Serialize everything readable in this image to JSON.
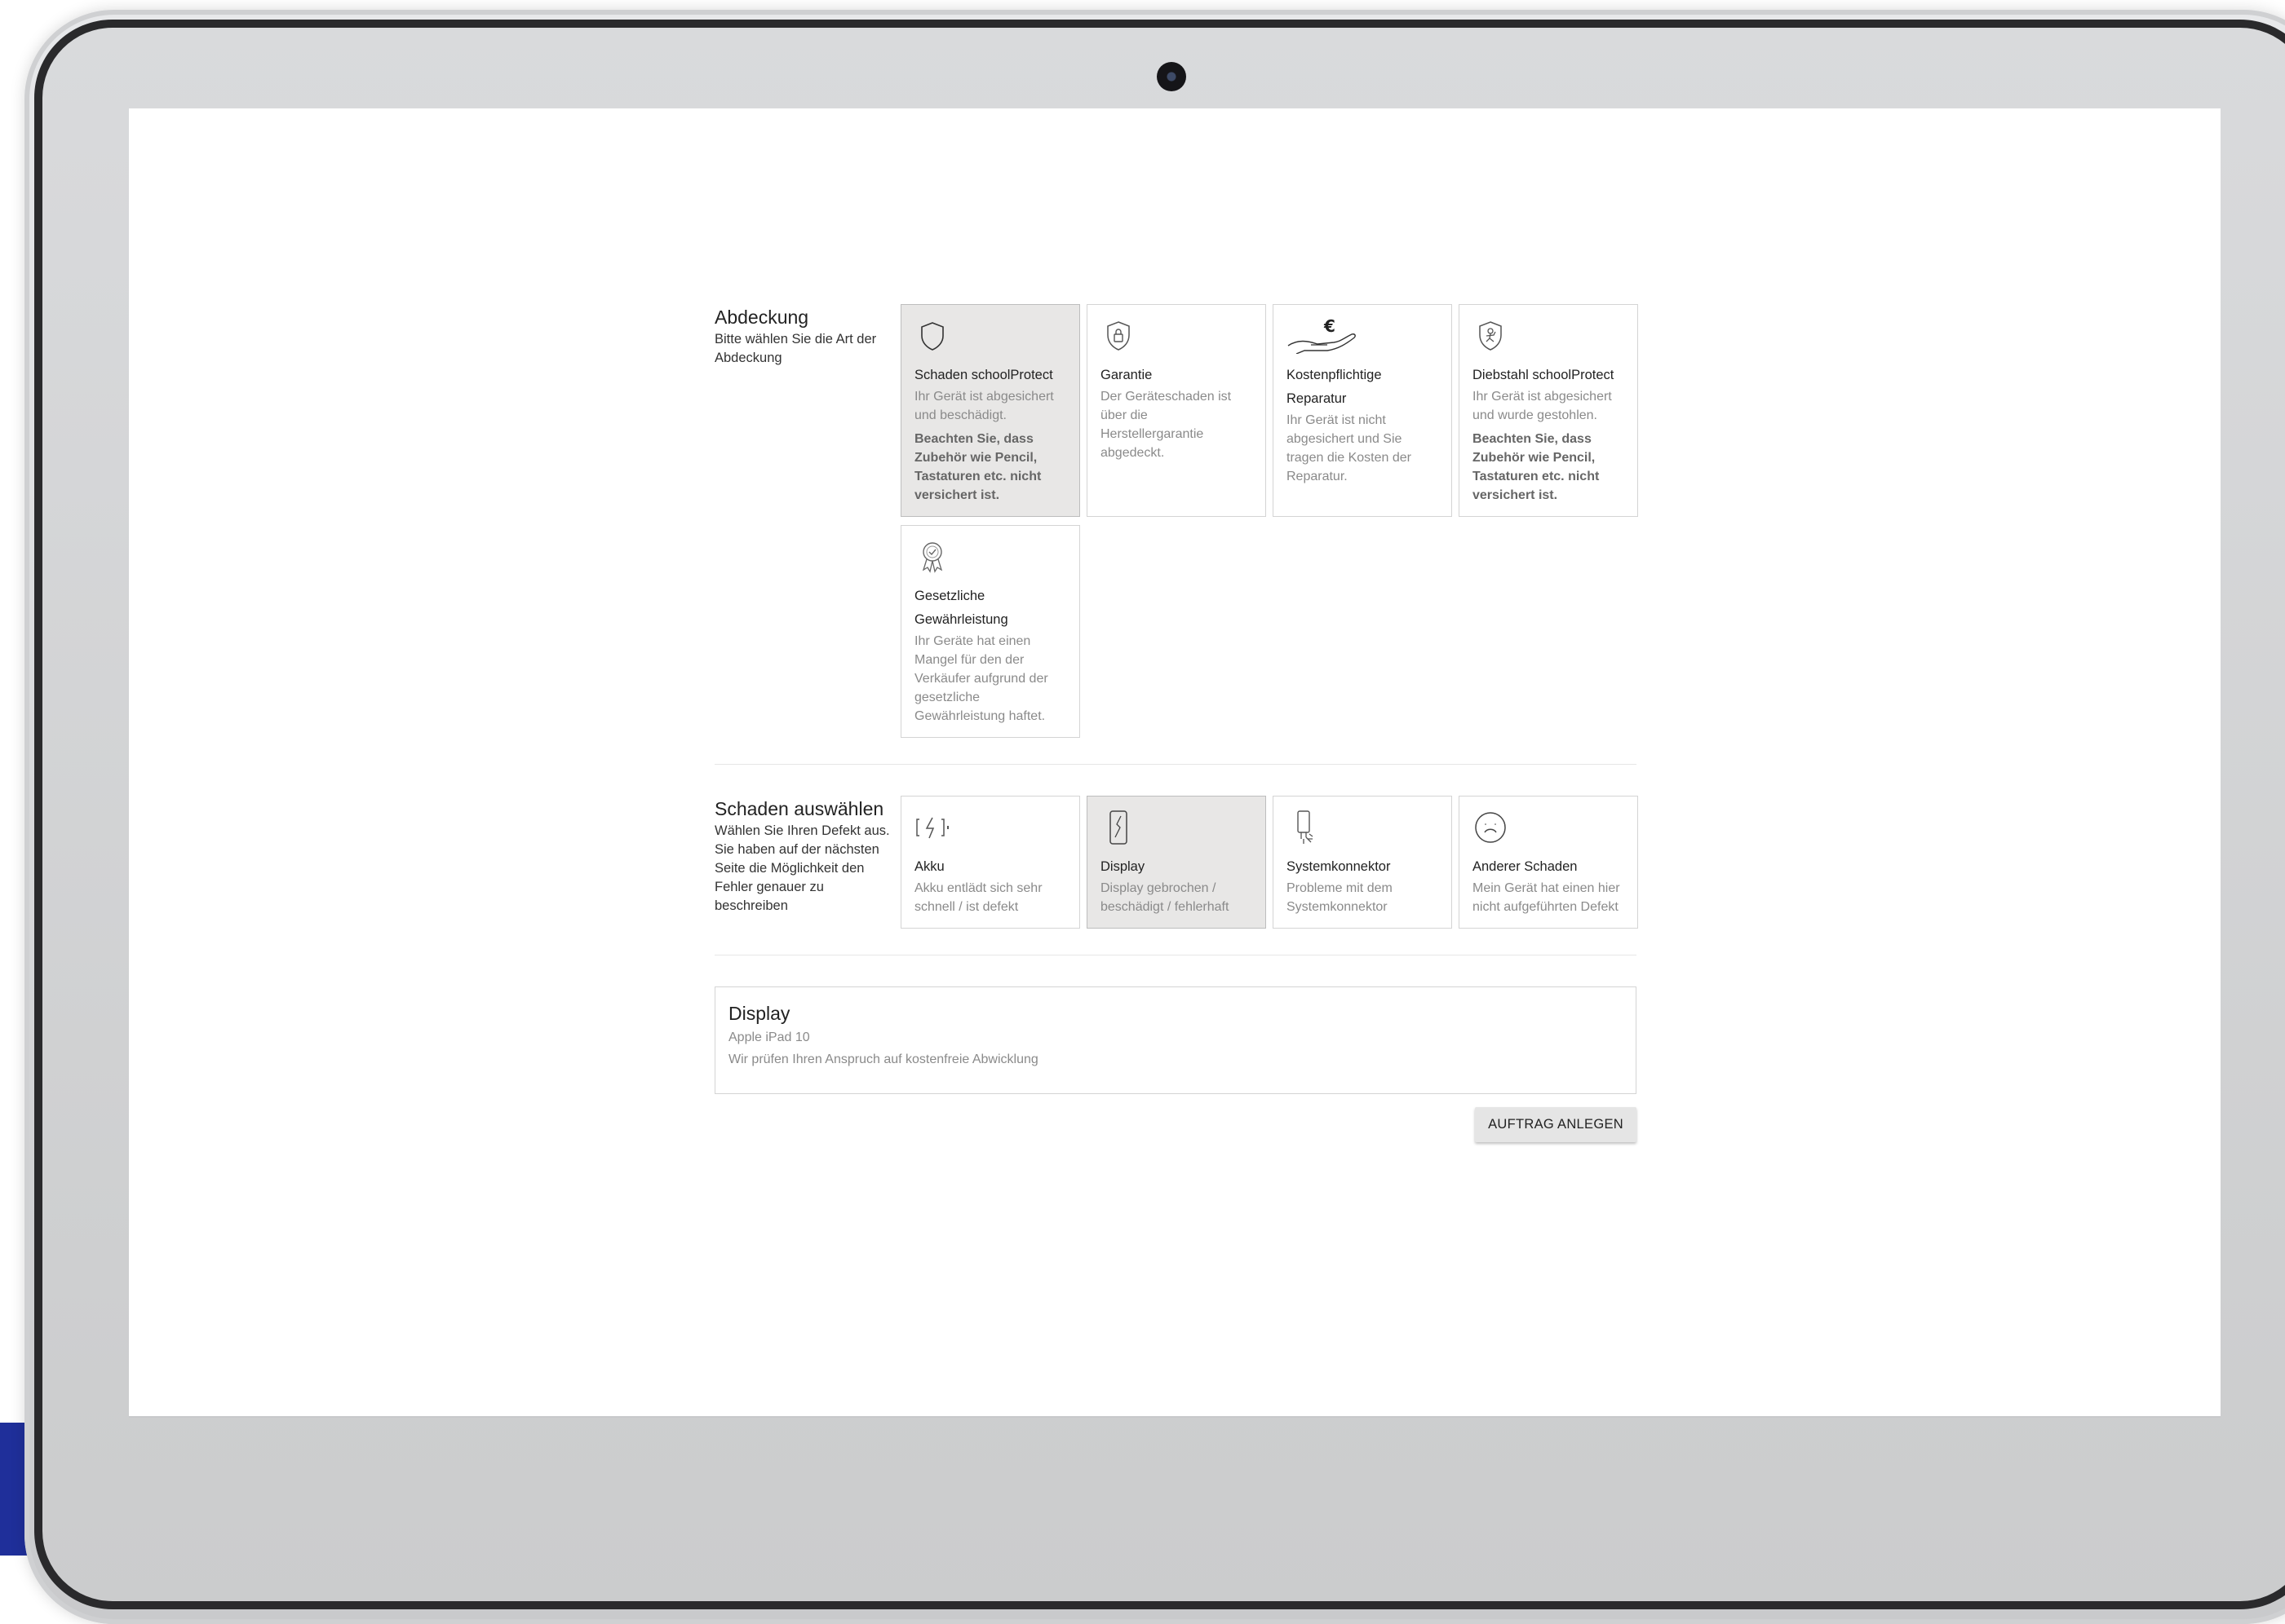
{
  "coverage": {
    "title": "Abdeckung",
    "description": "Bitte wählen Sie die Art der Abdeckung",
    "options": [
      {
        "title": "Schaden schoolProtect",
        "description": "Ihr Gerät ist abgesichert und beschädigt.",
        "note": "Beachten Sie, dass Zubehör wie Pencil, Tastaturen etc. nicht versichert ist.",
        "icon": "shield-icon",
        "selected": true
      },
      {
        "title": "Garantie",
        "description": "Der Geräteschaden ist über die Herstellergarantie abgedeckt.",
        "note": "",
        "icon": "shield-lock-icon",
        "selected": false
      },
      {
        "title": "Kostenpflichtige Reparatur",
        "description": "Ihr Gerät ist nicht abgesichert und Sie tragen die Kosten der Reparatur.",
        "note": "",
        "icon": "euro-hand-icon",
        "selected": false
      },
      {
        "title": "Diebstahl schoolProtect",
        "description": "Ihr Gerät ist abgesichert und wurde gestohlen.",
        "note": "Beachten Sie, dass Zubehör wie Pencil, Tastaturen etc. nicht versichert ist.",
        "icon": "shield-thief-icon",
        "selected": false
      },
      {
        "title": "Gesetzliche Gewährleistung",
        "description": "Ihr Geräte hat einen Mangel für den der Verkäufer aufgrund der gesetzliche Gewährleistung haftet.",
        "note": "",
        "icon": "award-badge-icon",
        "selected": false
      }
    ]
  },
  "damage": {
    "title": "Schaden auswählen",
    "description": "Wählen Sie Ihren Defekt aus. Sie haben auf der nächsten Seite die Möglichkeit den Fehler genauer zu beschreiben",
    "options": [
      {
        "title": "Akku",
        "description": "Akku entlädt sich sehr schnell / ist defekt",
        "icon": "battery-icon",
        "selected": false
      },
      {
        "title": "Display",
        "description": "Display gebrochen / beschädigt / fehlerhaft",
        "icon": "broken-display-icon",
        "selected": true
      },
      {
        "title": "Systemkonnektor",
        "description": "Probleme mit dem Systemkonnektor",
        "icon": "connector-icon",
        "selected": false
      },
      {
        "title": "Anderer Schaden",
        "description": "Mein Gerät hat einen hier nicht aufgeführten Defekt",
        "icon": "sad-face-icon",
        "selected": false
      }
    ]
  },
  "summary": {
    "title": "Display",
    "device": "Apple iPad 10",
    "message": "Wir prüfen Ihren Anspruch auf kostenfreie Abwicklung"
  },
  "actions": {
    "submit_label": "AUFTRAG ANLEGEN"
  },
  "colors": {
    "selected_card": "#e8e7e6",
    "border": "#d4d4d4",
    "accent_blue": "#1f2f9a"
  }
}
